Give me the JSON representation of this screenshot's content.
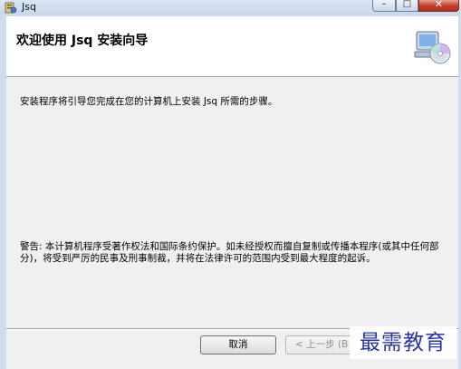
{
  "window": {
    "title": "Jsq",
    "controls": {
      "minimize": "–",
      "maximize": "□",
      "close": "✕"
    }
  },
  "header": {
    "title": "欢迎使用 Jsq 安装向导",
    "icon": "setup-disc-icon"
  },
  "body": {
    "intro": "安装程序将引导您完成在您的计算机上安装 Jsq 所需的步骤。",
    "warning": "警告: 本计算机程序受著作权法和国际条约保护。如未经授权而擅自复制或传播本程序(或其中任何部分)，将受到严厉的民事及刑事制裁，并将在法律许可的范围内受到最大程度的起诉。"
  },
  "buttons": {
    "cancel": "取消",
    "back": "< 上一步 (B"
  },
  "watermark": "最需教育"
}
